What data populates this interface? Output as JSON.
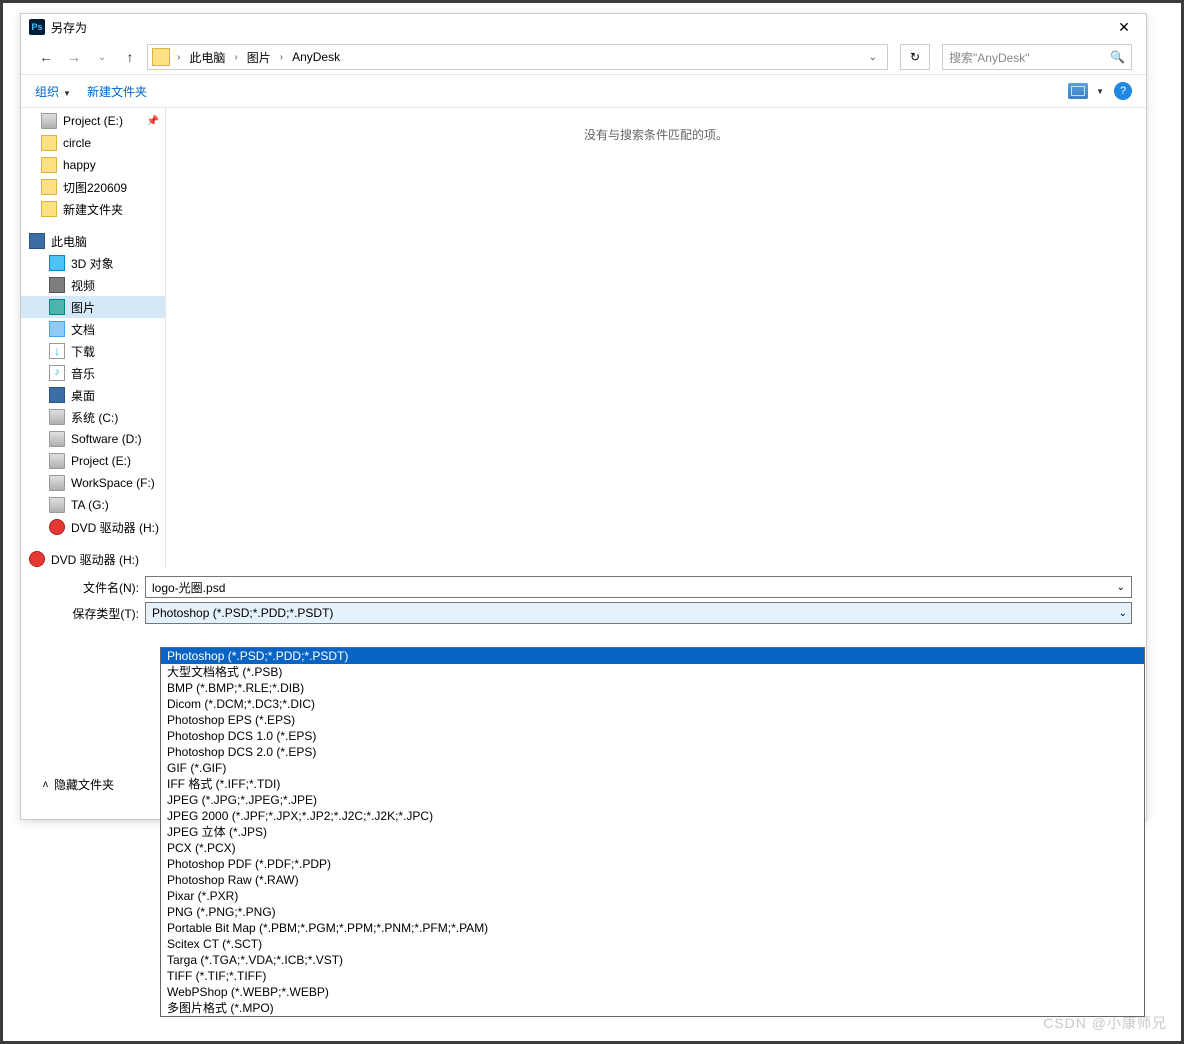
{
  "window": {
    "title": "另存为"
  },
  "nav": {
    "breadcrumb": [
      "此电脑",
      "图片",
      "AnyDesk"
    ],
    "search_placeholder": "搜索\"AnyDesk\""
  },
  "toolbar": {
    "organize": "组织",
    "new_folder": "新建文件夹"
  },
  "tree": {
    "quick": [
      {
        "icon": "drive",
        "label": "Project (E:)",
        "pinned": true
      },
      {
        "icon": "folder",
        "label": "circle"
      },
      {
        "icon": "folder",
        "label": "happy"
      },
      {
        "icon": "folder",
        "label": "切图220609"
      },
      {
        "icon": "folder",
        "label": "新建文件夹"
      }
    ],
    "pc_label": "此电脑",
    "pc": [
      {
        "icon": "3d",
        "label": "3D 对象"
      },
      {
        "icon": "vid",
        "label": "视频"
      },
      {
        "icon": "pic",
        "label": "图片",
        "selected": true
      },
      {
        "icon": "doc",
        "label": "文档"
      },
      {
        "icon": "dl",
        "label": "下载"
      },
      {
        "icon": "mus",
        "label": "音乐"
      },
      {
        "icon": "desk",
        "label": "桌面"
      },
      {
        "icon": "drive",
        "label": "系统 (C:)"
      },
      {
        "icon": "drive",
        "label": "Software (D:)"
      },
      {
        "icon": "drive",
        "label": "Project (E:)"
      },
      {
        "icon": "drive",
        "label": "WorkSpace (F:)"
      },
      {
        "icon": "drive",
        "label": "TA (G:)"
      },
      {
        "icon": "dvd",
        "label": "DVD 驱动器 (H:)"
      }
    ],
    "extra": {
      "icon": "dvd",
      "label": "DVD 驱动器 (H:)"
    }
  },
  "main": {
    "empty": "没有与搜索条件匹配的项。"
  },
  "fields": {
    "filename_label": "文件名(N):",
    "filename_value": "logo-光圈.psd",
    "savetype_label": "保存类型(T):",
    "savetype_value": "Photoshop (*.PSD;*.PDD;*.PSDT)"
  },
  "hide_folders": "隐藏文件夹",
  "format_options": [
    "Photoshop (*.PSD;*.PDD;*.PSDT)",
    "大型文档格式 (*.PSB)",
    "BMP (*.BMP;*.RLE;*.DIB)",
    "Dicom (*.DCM;*.DC3;*.DIC)",
    "Photoshop EPS (*.EPS)",
    "Photoshop DCS 1.0 (*.EPS)",
    "Photoshop DCS 2.0 (*.EPS)",
    "GIF (*.GIF)",
    "IFF 格式 (*.IFF;*.TDI)",
    "JPEG (*.JPG;*.JPEG;*.JPE)",
    "JPEG 2000 (*.JPF;*.JPX;*.JP2;*.J2C;*.J2K;*.JPC)",
    "JPEG 立体 (*.JPS)",
    "PCX (*.PCX)",
    "Photoshop PDF (*.PDF;*.PDP)",
    "Photoshop Raw (*.RAW)",
    "Pixar (*.PXR)",
    "PNG (*.PNG;*.PNG)",
    "Portable Bit Map (*.PBM;*.PGM;*.PPM;*.PNM;*.PFM;*.PAM)",
    "Scitex CT (*.SCT)",
    "Targa (*.TGA;*.VDA;*.ICB;*.VST)",
    "TIFF (*.TIF;*.TIFF)",
    "WebPShop (*.WEBP;*.WEBP)",
    "多图片格式 (*.MPO)"
  ],
  "watermark": "CSDN @小康师兄"
}
